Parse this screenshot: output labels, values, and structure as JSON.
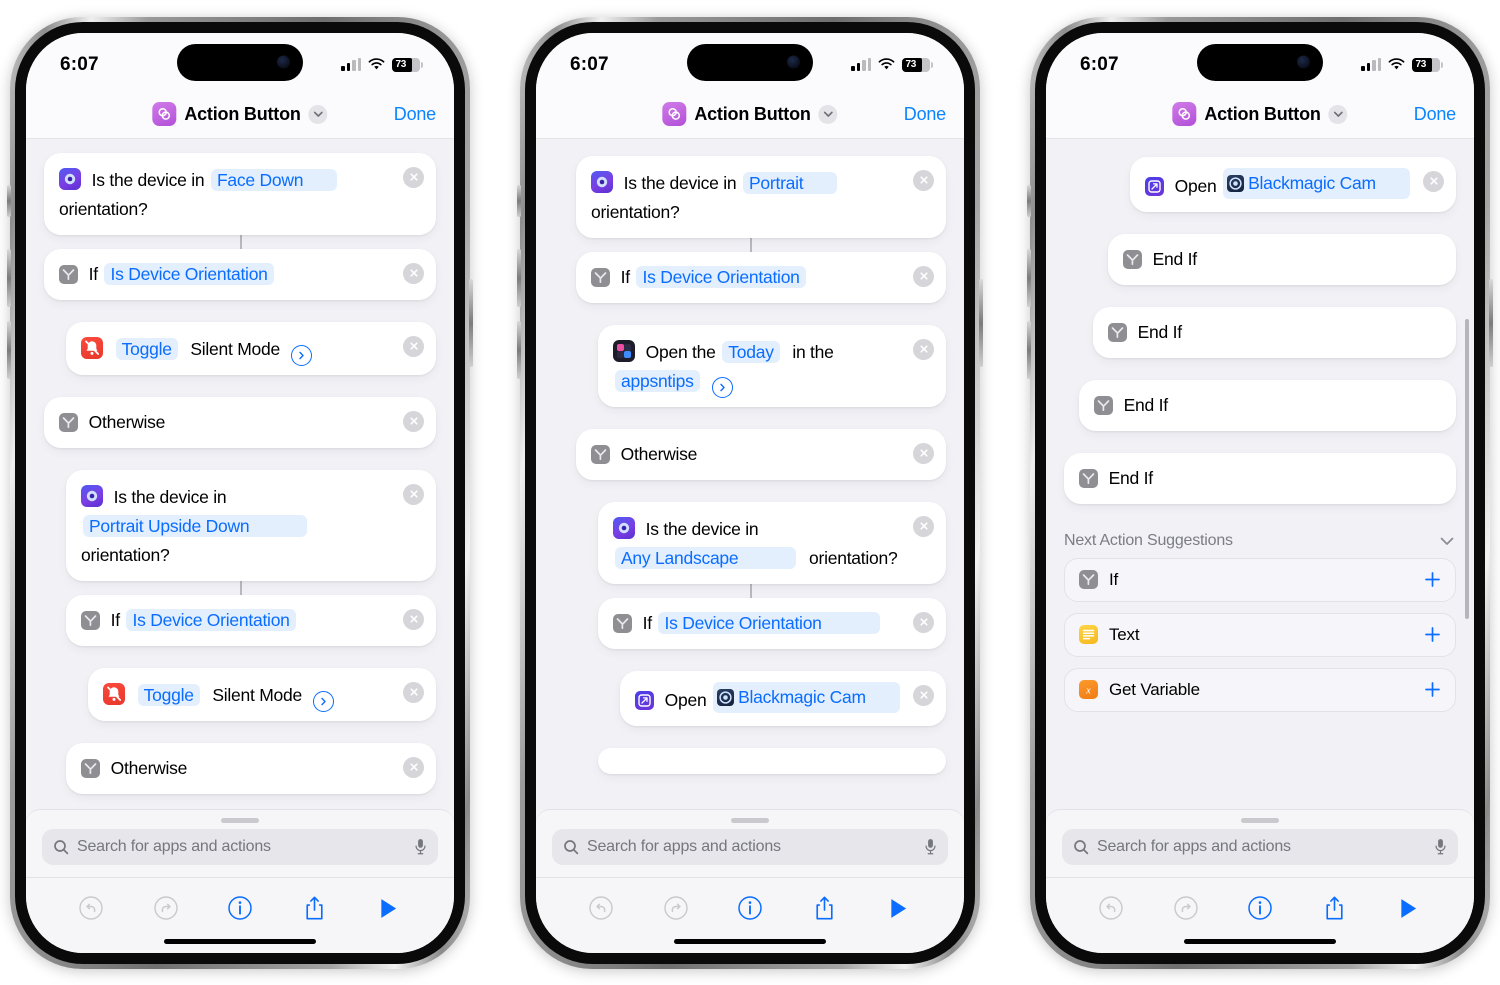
{
  "status_bar": {
    "time": "6:07",
    "battery": "73",
    "wifi_icon": "wifi-icon",
    "cellular_icon": "cellular-signal-icon",
    "battery_icon": "battery-icon"
  },
  "nav": {
    "title": "Action Button",
    "done_label": "Done",
    "app_icon": "shortcuts-icon",
    "chevron_icon": "chevron-down-icon"
  },
  "search": {
    "placeholder": "Search for apps and actions",
    "search_icon": "search-icon",
    "mic_icon": "microphone-icon"
  },
  "toolbar": {
    "undo_icon": "undo-icon",
    "redo_icon": "redo-icon",
    "info_icon": "info-circle-icon",
    "share_icon": "share-icon",
    "play_icon": "play-icon"
  },
  "phone1": {
    "rows": [
      {
        "name": "is-device-orientation-face-down",
        "icon": "orientation-icon",
        "pre": "Is the device in",
        "param": "Face Down",
        "post": "orientation?"
      },
      {
        "name": "if-is-device-orientation",
        "icon": "if-icon",
        "pre": "If",
        "param": "Is Device Orientation",
        "post": ""
      },
      {
        "name": "toggle-silent-mode",
        "icon": "silent-mode-icon",
        "pre": "",
        "param": "Toggle",
        "post": "Silent Mode"
      },
      {
        "name": "otherwise",
        "icon": "if-icon",
        "pre": "Otherwise",
        "param": "",
        "post": ""
      },
      {
        "name": "is-device-orientation-portrait-upside-down",
        "icon": "orientation-icon",
        "pre": "Is the device in",
        "param": "Portrait Upside Down",
        "post": "orientation?"
      },
      {
        "name": "if-is-device-orientation-2",
        "icon": "if-icon",
        "pre": "If",
        "param": "Is Device Orientation",
        "post": ""
      },
      {
        "name": "toggle-silent-mode-2",
        "icon": "silent-mode-icon",
        "pre": "",
        "param": "Toggle",
        "post": "Silent Mode"
      },
      {
        "name": "otherwise-2",
        "icon": "if-icon",
        "pre": "Otherwise",
        "param": "",
        "post": ""
      }
    ]
  },
  "phone2": {
    "rows": [
      {
        "name": "is-device-orientation-portrait",
        "icon": "orientation-icon",
        "pre": "Is the device in",
        "param": "Portrait",
        "post": "orientation?"
      },
      {
        "name": "if-is-device-orientation",
        "icon": "if-icon",
        "pre": "If",
        "param": "Is Device Orientation",
        "post": ""
      },
      {
        "name": "open-today-in-appsntips",
        "icon": "appsntips-icon",
        "pre": "Open the",
        "param": "Today",
        "mid": "in the",
        "param2": "appsntips"
      },
      {
        "name": "otherwise",
        "icon": "if-icon",
        "pre": "Otherwise",
        "param": "",
        "post": ""
      },
      {
        "name": "is-device-orientation-any-landscape",
        "icon": "orientation-icon",
        "pre": "Is the device in",
        "param": "Any Landscape",
        "post": "orientation?"
      },
      {
        "name": "if-is-device-orientation-2",
        "icon": "if-icon",
        "pre": "If",
        "param": "Is Device Orientation",
        "post": ""
      },
      {
        "name": "open-blackmagic-cam",
        "icon": "open-app-icon",
        "pre": "Open",
        "param": "Blackmagic Cam",
        "post": "",
        "param_icon": "blackmagic-cam-icon"
      }
    ]
  },
  "phone3": {
    "rows": [
      {
        "name": "open-blackmagic-cam",
        "icon": "open-app-icon",
        "pre": "Open",
        "param": "Blackmagic Cam",
        "post": "",
        "param_icon": "blackmagic-cam-icon"
      },
      {
        "name": "end-if-1",
        "icon": "if-icon",
        "pre": "End If",
        "param": "",
        "post": ""
      },
      {
        "name": "end-if-2",
        "icon": "if-icon",
        "pre": "End If",
        "param": "",
        "post": ""
      },
      {
        "name": "end-if-3",
        "icon": "if-icon",
        "pre": "End If",
        "param": "",
        "post": ""
      },
      {
        "name": "end-if-4",
        "icon": "if-icon",
        "pre": "End If",
        "param": "",
        "post": ""
      }
    ],
    "suggestions": {
      "title": "Next Action Suggestions",
      "chevron_icon": "chevron-down-icon",
      "items": [
        {
          "name": "suggestion-if",
          "label": "If",
          "icon": "if-icon",
          "add_icon": "plus-icon"
        },
        {
          "name": "suggestion-text",
          "label": "Text",
          "icon": "text-icon",
          "add_icon": "plus-icon"
        },
        {
          "name": "suggestion-get-variable",
          "label": "Get Variable",
          "icon": "get-variable-icon",
          "add_icon": "plus-icon"
        }
      ]
    }
  },
  "colors": {
    "accent": "#0a84ff",
    "param_text": "#0a6dff",
    "param_bg": "#e3effd",
    "canvas": "#f1f1f6"
  }
}
